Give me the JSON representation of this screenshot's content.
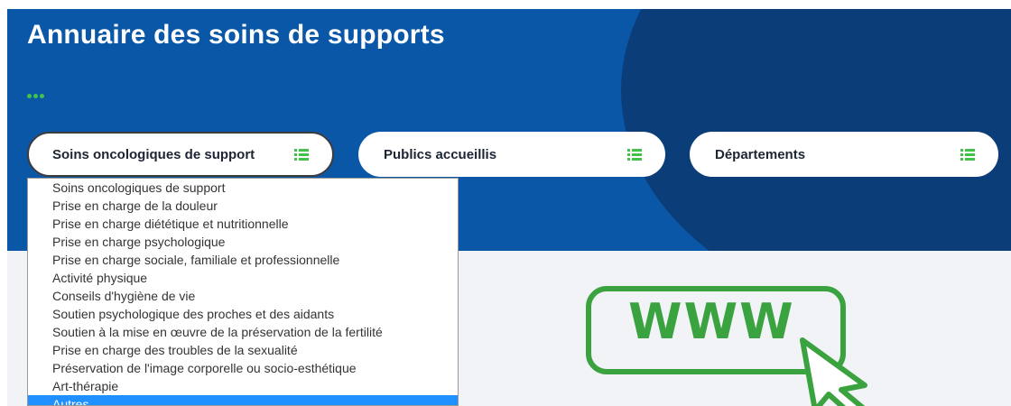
{
  "header": {
    "title": "Annuaire des soins de supports"
  },
  "filters": [
    {
      "label": "Soins oncologiques de support",
      "icon": "list-icon",
      "active": true
    },
    {
      "label": "Publics accueillis",
      "icon": "list-icon",
      "active": false
    },
    {
      "label": "Départements",
      "icon": "list-icon",
      "active": false
    }
  ],
  "dropdown": {
    "options": [
      "Soins oncologiques de support",
      "Prise en charge de la douleur",
      "Prise en charge diététique et nutritionnelle",
      "Prise en charge psychologique",
      "Prise en charge sociale, familiale et professionnelle",
      "Activité physique",
      "Conseils d'hygiène de vie",
      "Soutien psychologique des proches et des aidants",
      "Soutien à la mise en œuvre de la préservation de la fertilité",
      "Prise en charge des troubles de la sexualité",
      "Préservation de l'image corporelle ou socio-esthétique",
      "Art-thérapie",
      "Autres"
    ],
    "highlighted": "Autres"
  },
  "illustration": {
    "text": "WWW",
    "icon": "cursor-click-icon"
  },
  "colors": {
    "hero_blue": "#0a57a8",
    "hero_dark": "#0b3d78",
    "accent_green": "#43c24b",
    "illustration_green": "#3aa340",
    "selected_blue": "#1e90ff"
  }
}
